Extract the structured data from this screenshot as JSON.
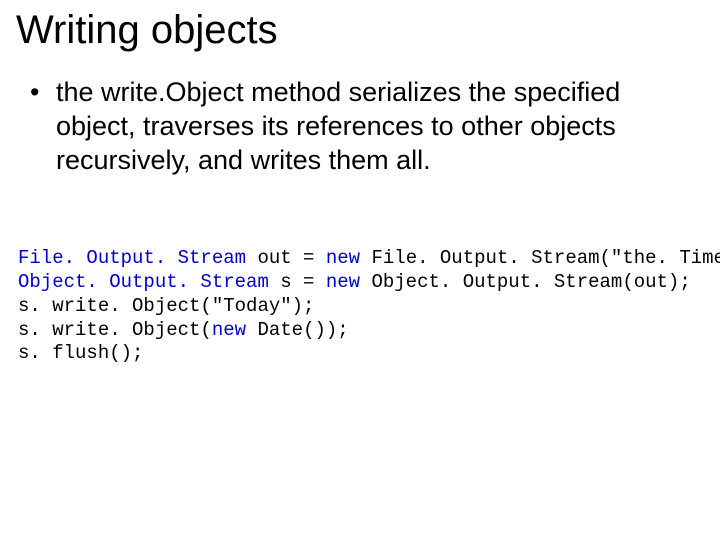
{
  "title": "Writing objects",
  "bullet1": "the write.Object method serializes the specified object, traverses its references to other objects recursively, and writes them all.",
  "code": {
    "l1a": "File. Output. Stream",
    "l1b": " out = ",
    "l1c": "new",
    "l1d": " File. Output. Stream(\"the. Time\");",
    "l2a": "Object. Output. Stream",
    "l2b": " s = ",
    "l2c": "new",
    "l2d": " Object. Output. Stream(out);",
    "l3": "s. write. Object(\"Today\");",
    "l4a": "s. write. Object(",
    "l4b": "new",
    "l4c": " Date());",
    "l5": "s. flush();"
  }
}
